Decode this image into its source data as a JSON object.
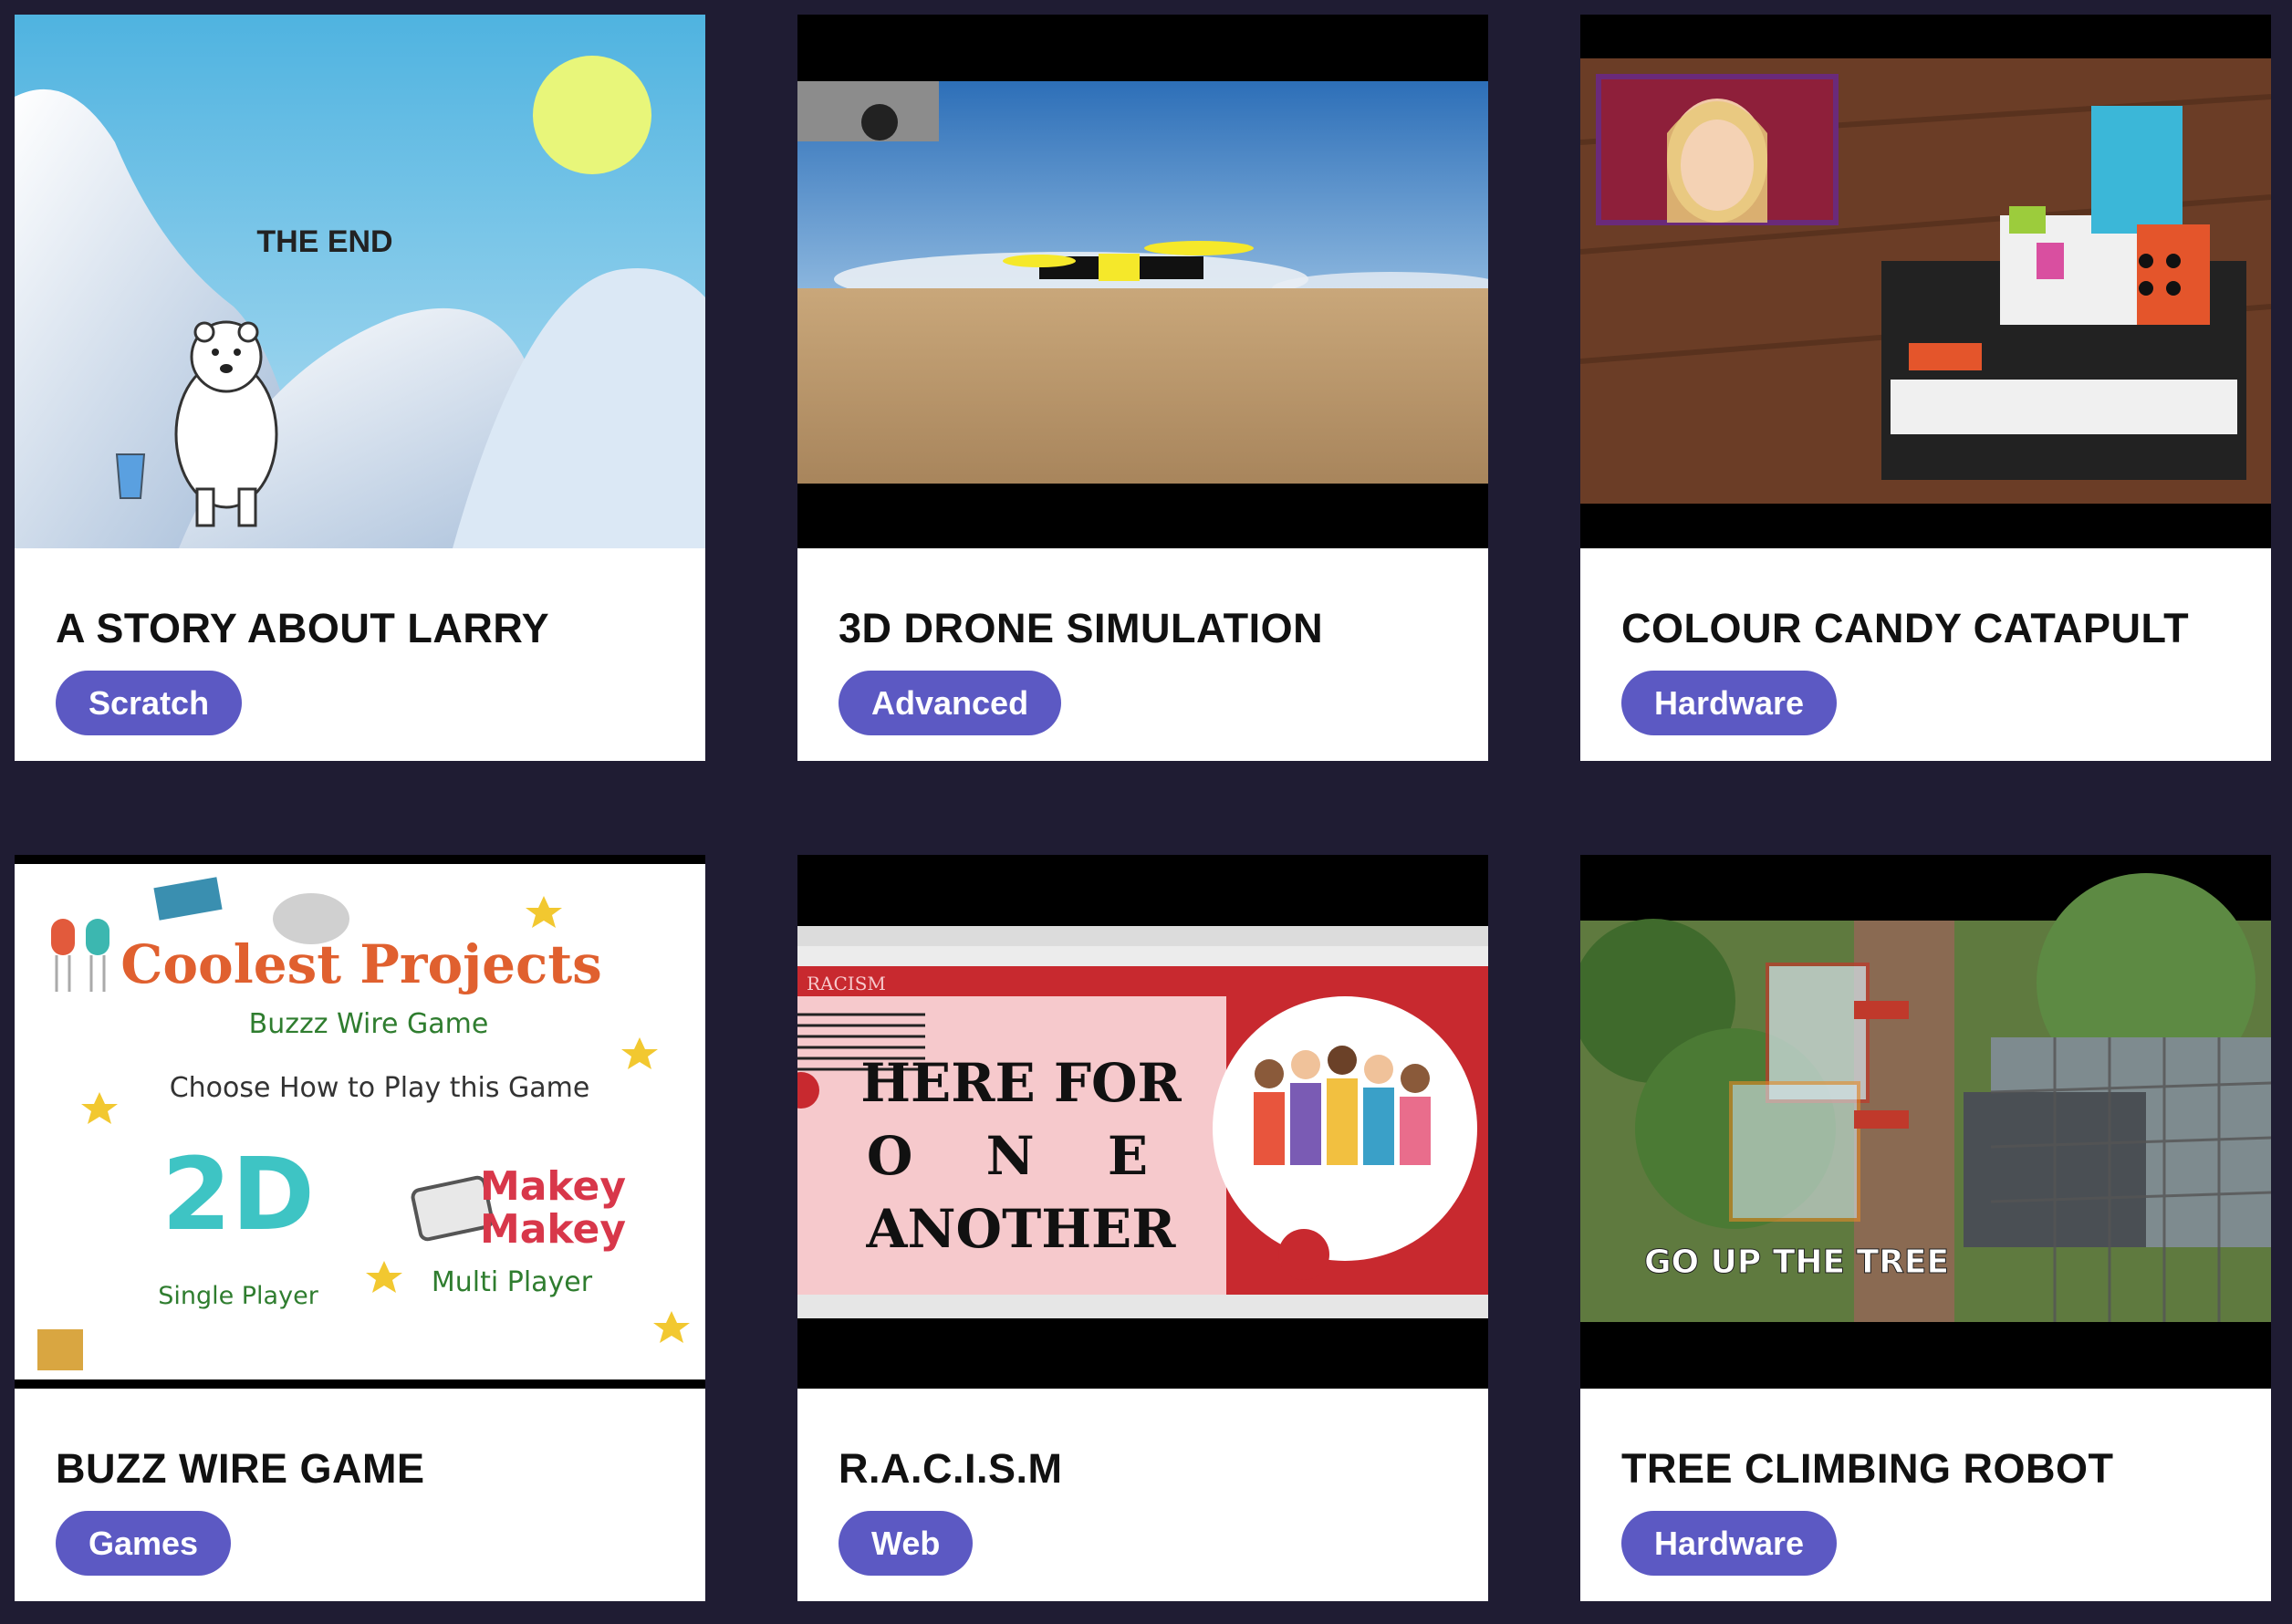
{
  "projects": [
    {
      "title": "A STORY ABOUT LARRY",
      "tag": "Scratch",
      "thumbnail": {
        "overlay_text": "THE END"
      }
    },
    {
      "title": "3D DRONE SIMULATION",
      "tag": "Advanced",
      "thumbnail": {}
    },
    {
      "title": "COLOUR CANDY CATAPULT",
      "tag": "Hardware",
      "thumbnail": {}
    },
    {
      "title": "BUZZ WIRE GAME",
      "tag": "Games",
      "thumbnail": {
        "heading": "Coolest Projects",
        "subheading": "Buzzz Wire Game",
        "prompt": "Choose How to Play this Game",
        "option1_logo": "2D",
        "option1_label": "Single Player",
        "option2_logo_line1": "Makey",
        "option2_logo_line2": "Makey",
        "option2_label": "Multi Player"
      }
    },
    {
      "title": "R.A.C.I.S.M",
      "tag": "Web",
      "thumbnail": {
        "site_name": "RACISM",
        "line1": "HERE FOR",
        "line2": "O N E",
        "line3": "ANOTHER"
      }
    },
    {
      "title": "TREE CLIMBING ROBOT",
      "tag": "Hardware",
      "thumbnail": {
        "caption": "GO UP THE TREE"
      }
    }
  ],
  "colors": {
    "page_background": "#1f1c33",
    "tag_background": "#5c59c3",
    "card_background": "#ffffff"
  }
}
